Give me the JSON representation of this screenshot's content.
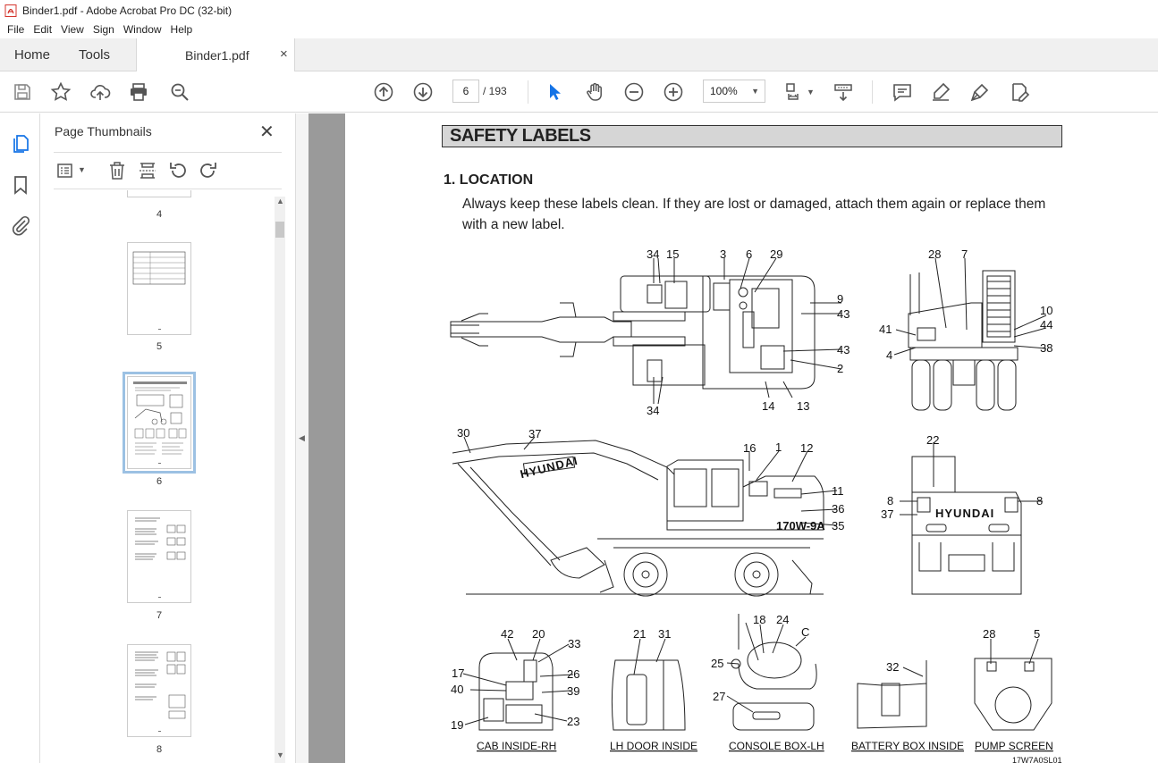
{
  "window": {
    "title": "Binder1.pdf - Adobe Acrobat Pro DC (32-bit)"
  },
  "menu": [
    "File",
    "Edit",
    "View",
    "Sign",
    "Window",
    "Help"
  ],
  "tabs": {
    "home": "Home",
    "tools": "Tools",
    "document": "Binder1.pdf",
    "close": "×"
  },
  "toolbar": {
    "page_current": "6",
    "page_total": "/ 193",
    "zoom": "100%"
  },
  "panel": {
    "title": "Page Thumbnails",
    "thumbnails": [
      {
        "label": "4"
      },
      {
        "label": "5"
      },
      {
        "label": "6",
        "selected": true
      },
      {
        "label": "7"
      },
      {
        "label": "8"
      }
    ]
  },
  "document": {
    "header": "SAFETY LABELS",
    "section": "1.  LOCATION",
    "paragraph": "Always keep these labels clean.  If they are lost or damaged, attach them again or replace them with a new label.",
    "figure": {
      "top_view_labels": [
        "34",
        "15",
        "3",
        "6",
        "29",
        "9",
        "43",
        "43",
        "2",
        "13",
        "14",
        "34"
      ],
      "rear_view_labels": [
        "28",
        "7",
        "10",
        "44",
        "38",
        "41",
        "4"
      ],
      "side_view_labels": [
        "30",
        "37",
        "16",
        "1",
        "12",
        "11",
        "36",
        "35"
      ],
      "back_view_labels": [
        "22",
        "8",
        "8",
        "37"
      ],
      "brand": "HYUNDAI",
      "model": "170W-9A",
      "cab_labels": [
        "42",
        "20",
        "33",
        "17",
        "26",
        "40",
        "39",
        "19",
        "23"
      ],
      "door_labels": [
        "21",
        "31"
      ],
      "console_labels": [
        "18",
        "24",
        "C",
        "25",
        "27"
      ],
      "battery_labels": [
        "32"
      ],
      "pump_labels": [
        "28",
        "5"
      ],
      "captions": [
        "CAB INSIDE-RH",
        "LH DOOR INSIDE",
        "CONSOLE BOX-LH",
        "BATTERY BOX INSIDE",
        "PUMP SCREEN"
      ],
      "code": "17W7A0SL01"
    }
  },
  "colors": {
    "accent_blue": "#1473e6",
    "selection": "#9cc1e3",
    "pdf_red": "#d4342c"
  }
}
